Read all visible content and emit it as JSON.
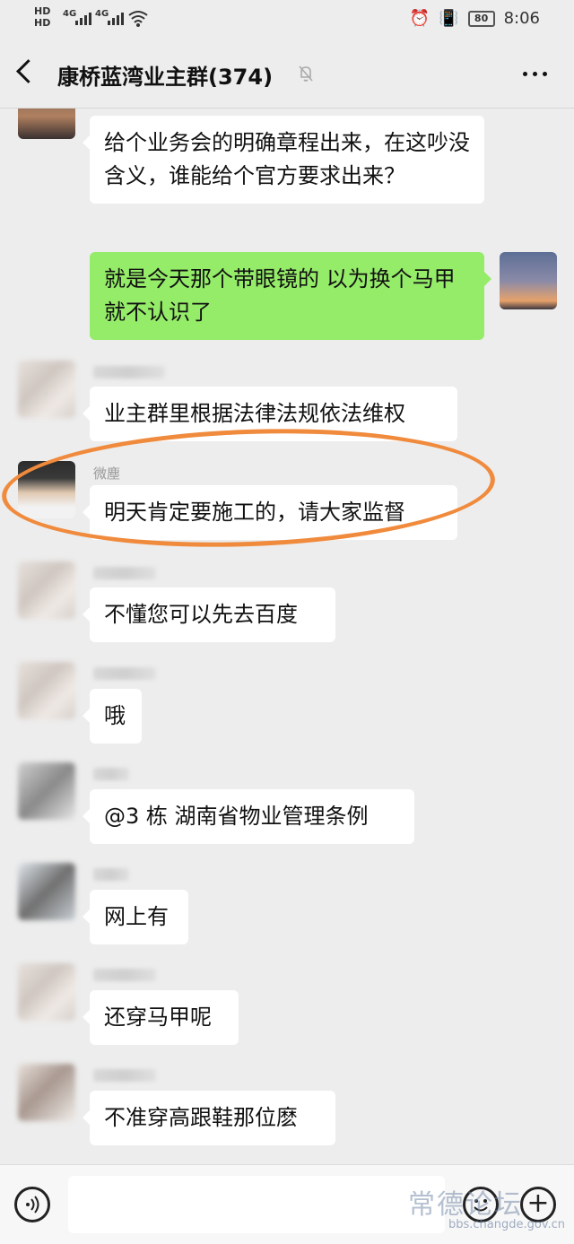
{
  "status": {
    "hd1": "HD",
    "hd2": "HD",
    "sig": "4G",
    "sig2": "4G",
    "battery": "80",
    "time": "8:06"
  },
  "header": {
    "title": "康桥蓝湾业主群(374)"
  },
  "messages": [
    {
      "side": "left",
      "text": "给个业务会的明确章程出来，在这吵没含义，谁能给个官方要求出来？"
    },
    {
      "side": "right",
      "text": "就是今天那个带眼镜的 以为换个马甲就不认识了"
    },
    {
      "side": "left",
      "text": "业主群里根据法律法规依法维权"
    },
    {
      "side": "left",
      "sender": "微塵",
      "text": "明天肯定要施工的，请大家监督"
    },
    {
      "side": "left",
      "text": "不懂您可以先去百度"
    },
    {
      "side": "left",
      "text": "哦"
    },
    {
      "side": "left",
      "text": "@3 栋  湖南省物业管理条例"
    },
    {
      "side": "left",
      "text": "网上有"
    },
    {
      "side": "left",
      "text": "还穿马甲呢"
    },
    {
      "side": "left",
      "text": "不准穿高跟鞋那位麽"
    }
  ],
  "watermark": {
    "text": "常德论坛",
    "url": "bbs.changde.gov.cn"
  }
}
